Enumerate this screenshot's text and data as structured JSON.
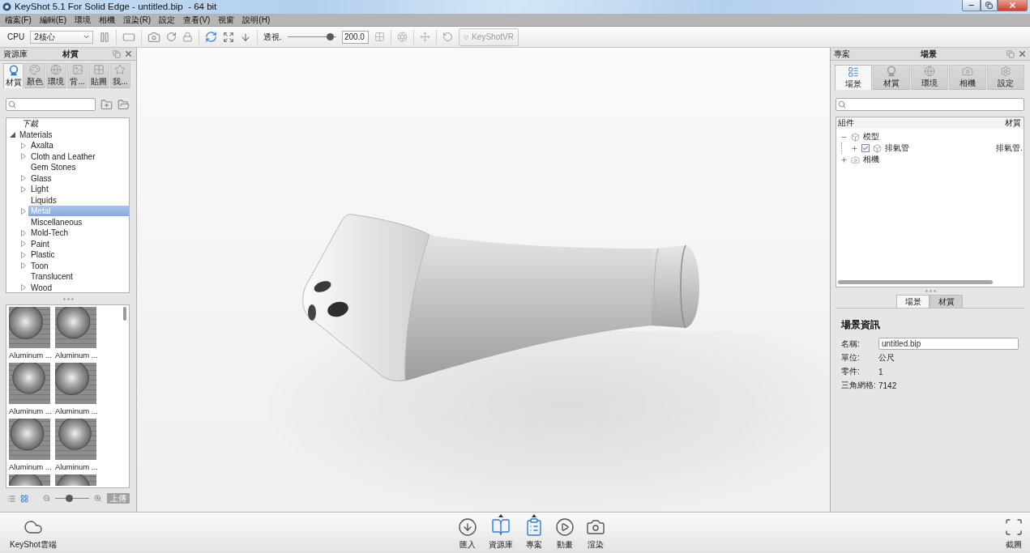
{
  "window": {
    "title": "KeyShot 5.1 For Solid Edge - untitled.bip  - 64 bit"
  },
  "menu_bar": [
    "檔案(F)",
    "編輯(E)",
    "環境",
    "相機",
    "渲染(R)",
    "設定",
    "查看(V)",
    "視窗",
    "說明(H)"
  ],
  "toolbar": {
    "cpu_label": "CPU",
    "cpu_select": "2核心",
    "view_label": "透視.",
    "fov_slider": {
      "level": 0.95
    },
    "fov_value": "200.0",
    "vr_button": {
      "label": "KeyShotVR",
      "disabled": true
    }
  },
  "library_panel": {
    "title": "資源庫",
    "subtitle": "材質",
    "tabs": [
      {
        "label": "材質",
        "kind": "material",
        "selected": true
      },
      {
        "label": "顏色",
        "kind": "color",
        "selected": false
      },
      {
        "label": "環境",
        "kind": "environment",
        "selected": false
      },
      {
        "label": "背...",
        "kind": "backplate",
        "selected": false
      },
      {
        "label": "貼圖",
        "kind": "texture",
        "selected": false
      },
      {
        "label": "我...",
        "kind": "favorites",
        "selected": false
      }
    ],
    "downloads_label": "下載",
    "tree": {
      "label": "Materials",
      "expanded": true,
      "children": [
        {
          "label": "Axalta",
          "expandable": true,
          "selected": false
        },
        {
          "label": "Cloth and Leather",
          "expandable": true,
          "selected": false
        },
        {
          "label": "Gem Stones",
          "expandable": false,
          "selected": false
        },
        {
          "label": "Glass",
          "expandable": true,
          "selected": false
        },
        {
          "label": "Light",
          "expandable": true,
          "selected": false
        },
        {
          "label": "Liquids",
          "expandable": false,
          "selected": false
        },
        {
          "label": "Metal",
          "expandable": true,
          "selected": true
        },
        {
          "label": "Miscellaneous",
          "expandable": false,
          "selected": false
        },
        {
          "label": "Mold-Tech",
          "expandable": true,
          "selected": false
        },
        {
          "label": "Paint",
          "expandable": true,
          "selected": false
        },
        {
          "label": "Plastic",
          "expandable": true,
          "selected": false
        },
        {
          "label": "Toon",
          "expandable": true,
          "selected": false
        },
        {
          "label": "Translucent",
          "expandable": false,
          "selected": false
        },
        {
          "label": "Wood",
          "expandable": true,
          "selected": false
        }
      ]
    },
    "thumbnails": [
      {
        "label": "Aluminum ...",
        "cut": false
      },
      {
        "label": "Aluminum ...",
        "cut": false
      },
      {
        "label": "Aluminum ...",
        "cut": false
      },
      {
        "label": "Aluminum ...",
        "cut": false
      },
      {
        "label": "Aluminum ...",
        "cut": false
      },
      {
        "label": "Aluminum ...",
        "cut": false
      },
      {
        "cut": true
      },
      {
        "cut": true
      }
    ],
    "view_modes": [
      {
        "kind": "list",
        "selected": false
      },
      {
        "kind": "grid",
        "selected": true
      }
    ],
    "zoom_slider": {
      "level": 0.38
    },
    "upload_button": "上傳"
  },
  "project_panel": {
    "title": "專案",
    "subtitle": "場景",
    "tabs": [
      {
        "label": "場景",
        "kind": "scene",
        "selected": true
      },
      {
        "label": "材質",
        "kind": "material",
        "selected": false
      },
      {
        "label": "環境",
        "kind": "environment",
        "selected": false
      },
      {
        "label": "相機",
        "kind": "camera",
        "selected": false
      },
      {
        "label": "設定",
        "kind": "settings",
        "selected": false
      }
    ],
    "scene_tree": {
      "columns": [
        "組件",
        "材質"
      ],
      "items": [
        {
          "label": "模型",
          "kind": "model",
          "expanded": true,
          "children": [
            {
              "label": "排氣管",
              "kind": "part",
              "expanded": false,
              "checked": true,
              "material": "排氣管."
            }
          ]
        },
        {
          "label": "相機",
          "kind": "camera",
          "expanded": false
        }
      ]
    },
    "sub_tabs": [
      {
        "label": "場景",
        "selected": true
      },
      {
        "label": "材質",
        "selected": false
      }
    ],
    "info": {
      "title": "場景資訊",
      "fields": [
        {
          "label": "名稱:",
          "value": "untitled.bip",
          "kind": "input"
        },
        {
          "label": "單位:",
          "value": "公尺",
          "kind": "text"
        },
        {
          "label": "零件:",
          "value": "1",
          "kind": "text"
        },
        {
          "label": "三角網格:",
          "value": "7142",
          "kind": "text"
        }
      ]
    }
  },
  "dock": {
    "cloud_button": "KeyShot雲端",
    "buttons": [
      {
        "label": "匯入",
        "kind": "import",
        "selected": false
      },
      {
        "label": "資源庫",
        "kind": "library",
        "selected": true
      },
      {
        "label": "專案",
        "kind": "project",
        "selected": true
      },
      {
        "label": "動畫",
        "kind": "animation",
        "selected": false
      },
      {
        "label": "渲染",
        "kind": "render",
        "selected": false
      }
    ],
    "screenshot_button": "截圖"
  }
}
